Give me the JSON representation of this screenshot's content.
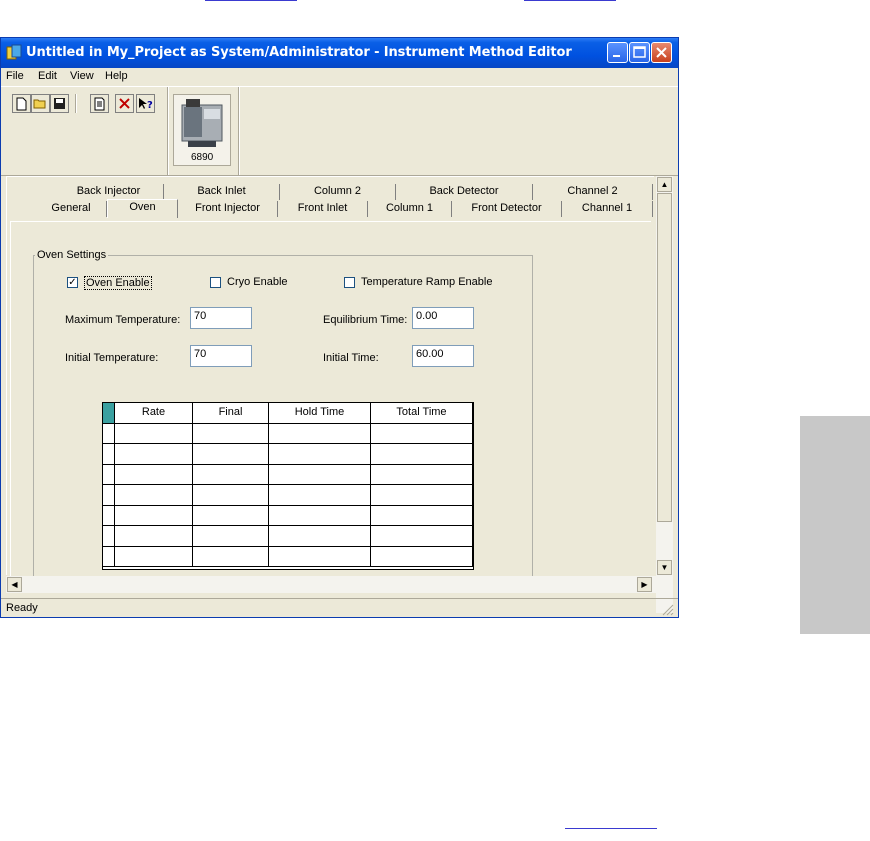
{
  "window": {
    "title": "Untitled in My_Project as System/Administrator - Instrument Method Editor",
    "controls": [
      "minimize",
      "maximize",
      "close"
    ]
  },
  "menu": [
    "File",
    "Edit",
    "View",
    "Help"
  ],
  "toolbar": {
    "buttons": [
      "new-icon",
      "open-icon",
      "save-icon",
      "report-icon",
      "delete-icon",
      "help-icon"
    ],
    "instrument_label": "6890"
  },
  "tabs": {
    "back_row": [
      "Back Injector",
      "Back Inlet",
      "Column 2",
      "Back Detector",
      "Channel 2"
    ],
    "front_row": [
      "General",
      "Oven",
      "Front Injector",
      "Front Inlet",
      "Column 1",
      "Front Detector",
      "Channel 1"
    ],
    "active": "Oven"
  },
  "oven": {
    "group_label": "Oven Settings",
    "oven_enable": {
      "label": "Oven Enable",
      "checked": true
    },
    "cryo_enable": {
      "label": "Cryo Enable",
      "checked": false
    },
    "temp_ramp_enable": {
      "label": "Temperature Ramp Enable",
      "checked": false
    },
    "max_temp": {
      "label": "Maximum Temperature:",
      "value": "70"
    },
    "initial_temp": {
      "label": "Initial Temperature:",
      "value": "70"
    },
    "equilibrium_time": {
      "label": "Equilibrium Time:",
      "value": "0.00"
    },
    "initial_time": {
      "label": "Initial Time:",
      "value": "60.00"
    },
    "ramp_table": {
      "columns": [
        "Rate",
        "Final",
        "Hold Time",
        "Total Time"
      ],
      "rows": 7
    }
  },
  "status": "Ready"
}
